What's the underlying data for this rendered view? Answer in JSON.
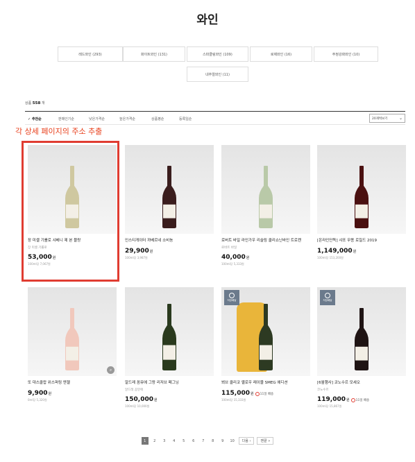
{
  "page_title": "와인",
  "categories": [
    "레드와인 (293)",
    "화이트와인 (131)",
    "스파클링와인 (109)",
    "로제와인 (16)",
    "주정강화와인 (10)",
    "내추럴와인 (11)"
  ],
  "product_count": {
    "prefix": "상품 ",
    "number": "558",
    "suffix": " 개"
  },
  "sort_options": [
    "추천순",
    "판매인기순",
    "낮은가격순",
    "높은가격순",
    "상품평순",
    "등록일순"
  ],
  "per_page": "20개씩보기",
  "annotation": "각 상세 페이지의 주소 추출",
  "products": [
    {
      "name": "장 미셸 기롤로 샤베니 제 본 블랑",
      "sub": "장 미셸 기롤로",
      "price": "53,000",
      "won": "원",
      "per": "100ml당 7,067원",
      "bottle": "#cfc8a0",
      "badge": "",
      "delivery": ""
    },
    {
      "name": "인스티게이터 까베르네 소비뇽",
      "sub": "",
      "price": "29,900",
      "won": "원",
      "per": "100ml당 3,987원",
      "bottle": "#3a1d1d",
      "badge": "",
      "delivery": ""
    },
    {
      "name": "로버트 바일 라인가우 리슬링 클리쇼닌바인 트로켄",
      "sub": "로버트 바일",
      "price": "40,000",
      "won": "원",
      "per": "100ml당 5,333원",
      "bottle": "#b9c9a8",
      "badge": "",
      "delivery": ""
    },
    {
      "name": "[온라인단독] 샤또 무똥 로칠드 2019",
      "sub": "",
      "price": "1,149,000",
      "won": "원",
      "per": "100ml당 153,200원",
      "bottle": "#4a1010",
      "badge": "",
      "delivery": ""
    },
    {
      "name": "또 대스클랍 위스퍼링 엔젤",
      "sub": "",
      "price": "9,900",
      "won": "원",
      "per": "0ml당 5,320원",
      "bottle": "#f1c8bc",
      "badge": "",
      "delivery": ""
    },
    {
      "name": "알드레 꼼뮤에 그랑 리저브 페그닝",
      "sub": "알드레 꼼뮤에",
      "price": "150,000",
      "won": "원",
      "per": "100ml당 10,000원",
      "bottle": "#2a3a1e",
      "badge": "",
      "delivery": ""
    },
    {
      "name": "뵈브 클리코 옐로우 레이블 SMEG 에디션",
      "sub": "",
      "price": "115,000",
      "won": "원",
      "per": "100ml당 15,333원",
      "bottle": "#2d3a22",
      "badge": "저장배달",
      "delivery": "11일 배송"
    },
    {
      "name": "[6월행사] 코노수르 모세오",
      "sub": "코노수르",
      "price": "119,000",
      "won": "원",
      "per": "100ml당 15,867원",
      "bottle": "#1f1414",
      "badge": "저장배달",
      "delivery": "11일 배송"
    }
  ],
  "pagination": {
    "pages": [
      "1",
      "2",
      "3",
      "4",
      "5",
      "6",
      "7",
      "8",
      "9",
      "10"
    ],
    "next": "다음 ›",
    "last": "맨끝 »"
  },
  "colors": {
    "accent": "#e03c31",
    "annotation": "#e8401c"
  }
}
